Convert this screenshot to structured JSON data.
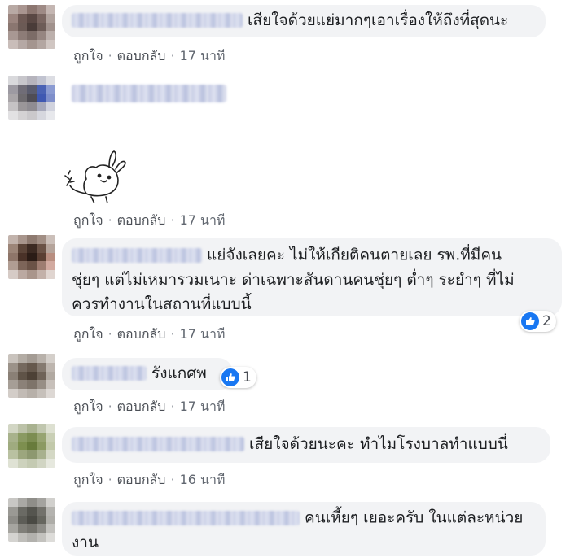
{
  "actions": {
    "like": "ถูกใจ",
    "reply": "ตอบกลับ",
    "separator": "·"
  },
  "colors": {
    "bubble": "#f2f3f5",
    "like_blue": "#1877f2",
    "meta_text": "#616770"
  },
  "comments": [
    {
      "text": "เสียใจด้วยแย่มากๆเอาเรื่องให้ถึงที่สุดนะ",
      "time": "17 นาที"
    },
    {
      "text": "",
      "sticker": "bunny-sticker",
      "time": "17 นาที"
    },
    {
      "text": "แย่จังเลยคะ ไม่ให้เกียติคนตายเลย รพ.ที่มีคนชุ่ยๆ แต่ไม่เหมารวมเนาะ ด่าเฉพาะสันดานคนชุ่ยๆ ต่ำๆ ระยำๆ ที่ไม่ควรทำงานในสถานที่แบบนี้",
      "line1": "แย่จังเลยคะ ไม่ให้เกียติคนตายเลย รพ.ที่มีคน",
      "line2": "ชุ่ยๆ แต่ไม่เหมารวมเนาะ ด่าเฉพาะสันดานคนชุ่ยๆ ต่ำๆ ระยำๆ ที่ไม่",
      "line3": "ควรทำงานในสถานที่แบบนี้",
      "time": "17 นาที",
      "reactions": "2",
      "reaction_icon": "like-icon"
    },
    {
      "text": "รังแกศพ",
      "time": "17 นาที",
      "reactions": "1",
      "reaction_icon": "like-icon"
    },
    {
      "text": "เสียใจด้วยนะคะ ทำไมโรงบาลทำแบบนี่",
      "time": "16 นาที"
    },
    {
      "text": "คนเหี้ยๆ เยอะครับ ในแต่ละหน่วยงาน",
      "line1": "คนเหี้ยๆ เยอะครับ ในแต่ละหน่วย",
      "line2": "งาน"
    }
  ]
}
